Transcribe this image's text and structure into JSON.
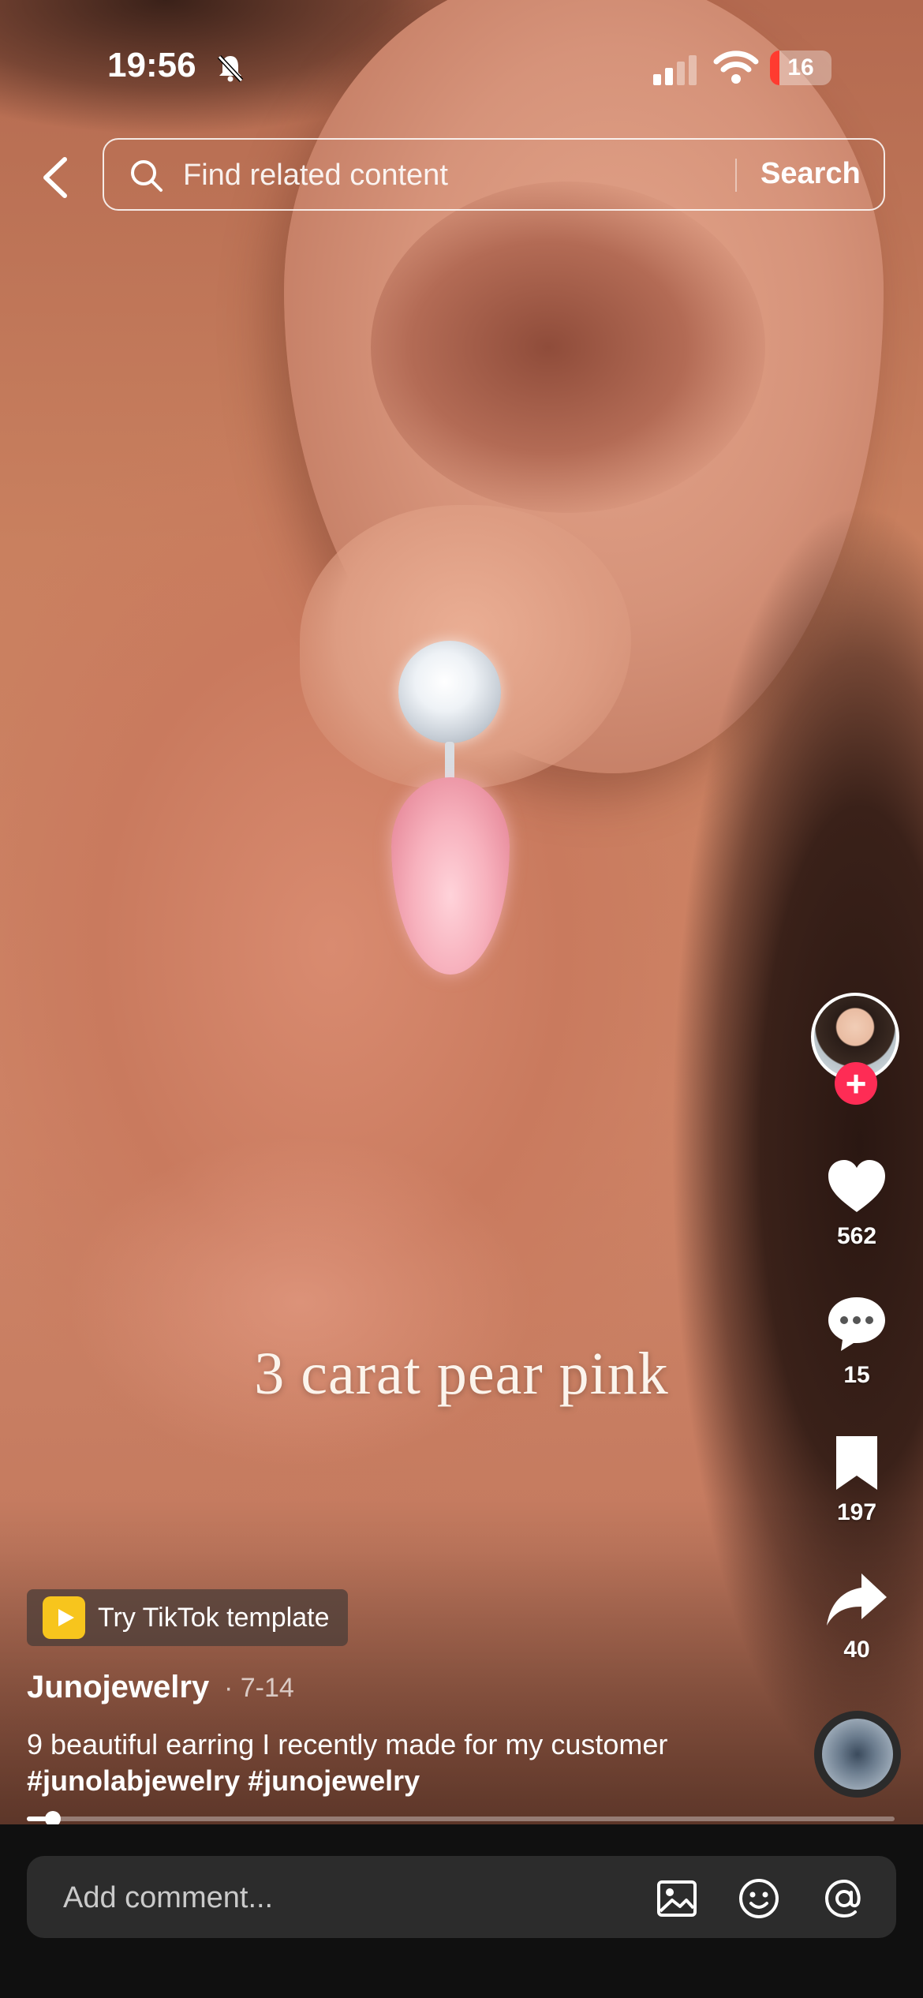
{
  "status_bar": {
    "time": "19:56",
    "battery": "16",
    "battery_level": 0.16
  },
  "search": {
    "placeholder": "Find related content",
    "button_label": "Search"
  },
  "video": {
    "overlay_text": "3 carat pear pink"
  },
  "actions": {
    "likes": "562",
    "comments": "15",
    "saves": "197",
    "shares": "40"
  },
  "template_chip": {
    "label": "Try TikTok template"
  },
  "post": {
    "username": "Junojewelry",
    "date": "· 7-14",
    "caption_text": "9 beautiful earring I recently made for my customer ",
    "hashtags": [
      "#junolabjewelry",
      "#junojewelry"
    ]
  },
  "playback": {
    "progress": 0.03
  },
  "comment_bar": {
    "placeholder": "Add comment..."
  },
  "colors": {
    "follow_accent": "#fe2c55",
    "template_icon": "#f7c51d",
    "battery_low": "#ff3b30"
  }
}
